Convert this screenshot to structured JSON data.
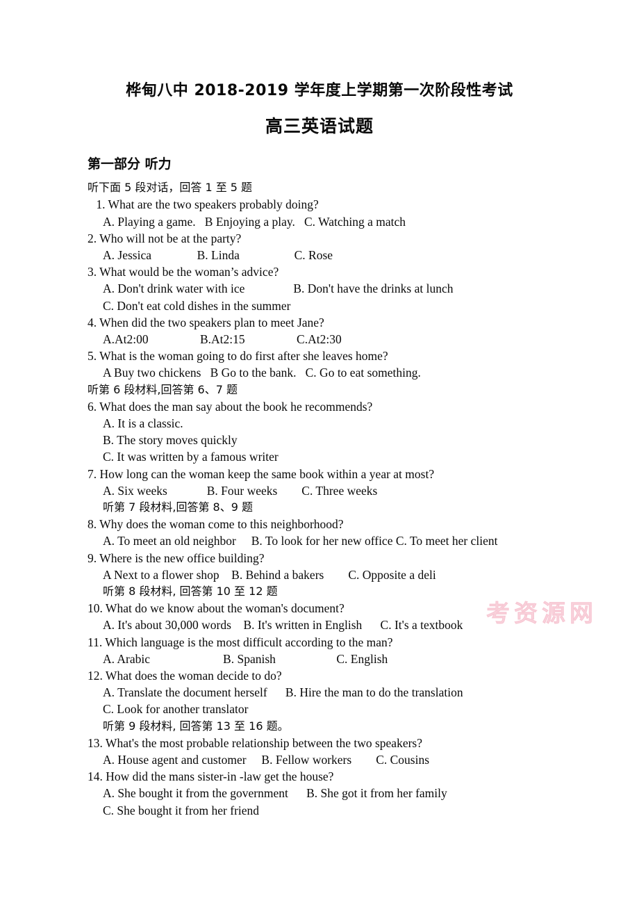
{
  "document": {
    "title": "桦甸八中  2018-2019 学年度上学期第一次阶段性考试",
    "subtitle": "高三英语试题",
    "watermark": "考资源网"
  },
  "part_one": {
    "heading": "第一部分  听力",
    "directions_1_5": "听下面 5 段对话，回答 1 至 5 题",
    "directions_6_7": "听第 6 段材料,回答第 6、7 题",
    "directions_8_9": "听第 7 段材料,回答第 8、9 题",
    "directions_10_12": "听第 8 段材料, 回答第 10 至 12 题",
    "directions_13_16": "听第 9 段材料, 回答第 13 至 16 题。"
  },
  "questions": [
    {
      "number": " 1.",
      "stem": " 1. What are the two speakers probably doing?",
      "options": [
        "A. Playing a game.   B Enjoying a play.   C. Watching a match"
      ]
    },
    {
      "number": "2.",
      "stem": "2. Who will not be at the party?",
      "options": [
        "A. Jessica               B. Linda                  C. Rose"
      ]
    },
    {
      "number": "3.",
      "stem": "3. What would be the woman’s advice?",
      "options": [
        "A. Don't drink water with ice                B. Don't have the drinks at lunch",
        "C. Don't eat cold dishes in the summer"
      ]
    },
    {
      "number": "4.",
      "stem": "4. When did the two speakers plan to meet Jane?",
      "options": [
        "A.At2:00                 B.At2:15                 C.At2:30"
      ]
    },
    {
      "number": "5.",
      "stem": "5. What is the woman going to do first after she leaves home?",
      "options": [
        "A Buy two chickens   B Go to the bank.   C. Go to eat something."
      ]
    },
    {
      "number": "6.",
      "stem": "6. What does the man say about the book he recommends?",
      "options": [
        "A. It is a classic.",
        "B. The story moves quickly",
        "C. It was written by a famous writer"
      ]
    },
    {
      "number": "7.",
      "stem": "7. How long can the woman keep the same book within a year at most?",
      "options": [
        "A. Six weeks             B. Four weeks        C. Three weeks"
      ]
    },
    {
      "number": "8.",
      "stem": "8. Why does the woman come to this neighborhood?",
      "options": [
        "A. To meet an old neighbor     B. To look for her new office C. To meet her client"
      ]
    },
    {
      "number": "9.",
      "stem": "9. Where is the new office building?",
      "options": [
        "A Next to a flower shop    B. Behind a bakers        C. Opposite a deli"
      ]
    },
    {
      "number": "10.",
      "stem": "10. What do we know about the woman's document?",
      "options": [
        "A. It's about 30,000 words    B. It's written in English      C. It's a textbook"
      ]
    },
    {
      "number": "11.",
      "stem": "11. Which language is the most difficult according to the man?",
      "options": [
        "A. Arabic                        B. Spanish                    C. English"
      ]
    },
    {
      "number": "12.",
      "stem": "12. What does the woman decide to do?",
      "options": [
        "A. Translate the document herself      B. Hire the man to do the translation",
        "C. Look for another translator"
      ]
    },
    {
      "number": "13.",
      "stem": "13. What's the most probable relationship between the two speakers?",
      "options": [
        "A. House agent and customer     B. Fellow workers        C. Cousins"
      ]
    },
    {
      "number": "14.",
      "stem": "14. How did the mans sister-in -law get the house?",
      "options": [
        "A. She bought it from the government      B. She got it from her family",
        "C. She bought it from her friend"
      ]
    }
  ]
}
